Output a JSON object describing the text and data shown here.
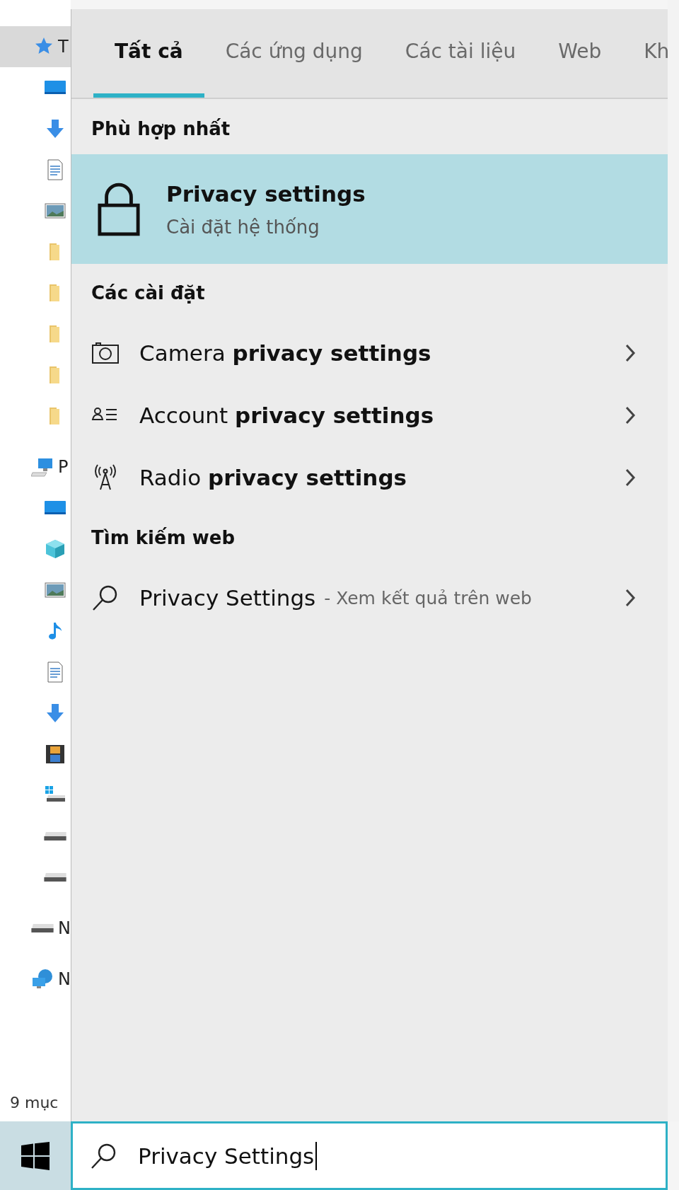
{
  "explorer": {
    "tree": [
      {
        "kind": "star",
        "label": "T",
        "selected": true,
        "children": [
          {
            "kind": "desktop",
            "selected": false
          },
          {
            "kind": "download",
            "selected": false
          },
          {
            "kind": "document",
            "selected": false
          },
          {
            "kind": "image",
            "selected": false
          },
          {
            "kind": "folder",
            "selected": false
          },
          {
            "kind": "folder",
            "selected": false
          },
          {
            "kind": "folder",
            "selected": false
          },
          {
            "kind": "folder",
            "selected": false
          },
          {
            "kind": "folder",
            "selected": false
          }
        ]
      },
      {
        "kind": "computer",
        "label": "P",
        "selected": false,
        "children": [
          {
            "kind": "desktop",
            "selected": false
          },
          {
            "kind": "cube",
            "selected": false
          },
          {
            "kind": "image",
            "selected": false
          },
          {
            "kind": "music",
            "selected": false
          },
          {
            "kind": "document",
            "selected": false
          },
          {
            "kind": "download",
            "selected": false
          },
          {
            "kind": "film",
            "selected": false
          },
          {
            "kind": "system-drive",
            "selected": false
          },
          {
            "kind": "drive",
            "selected": false
          },
          {
            "kind": "drive",
            "selected": false
          }
        ]
      },
      {
        "kind": "drive",
        "label": "N",
        "selected": false
      },
      {
        "kind": "network",
        "label": "N",
        "selected": false
      }
    ],
    "status": "9 mục"
  },
  "search": {
    "tabs": [
      {
        "label": "Tất cả",
        "selected": true
      },
      {
        "label": "Các ứng dụng",
        "selected": false
      },
      {
        "label": "Các tài liệu",
        "selected": false
      },
      {
        "label": "Web",
        "selected": false
      },
      {
        "label": "Kh",
        "selected": false
      }
    ],
    "best_match": {
      "heading": "Phù hợp nhất",
      "title": "Privacy settings",
      "subtitle": "Cài đặt hệ thống",
      "selected": true
    },
    "settings": {
      "heading": "Các cài đặt",
      "items": [
        {
          "kind": "camera",
          "label": "Camera **privacy settings**"
        },
        {
          "kind": "account",
          "label": "Account **privacy settings**"
        },
        {
          "kind": "radio",
          "label": "Radio **privacy settings**"
        }
      ]
    },
    "web": {
      "heading": "Tìm kiếm web",
      "items": [
        {
          "query": "Privacy Settings",
          "hint": "- Xem kết quả trên web"
        }
      ]
    },
    "field": {
      "value": "Privacy Settings"
    }
  }
}
